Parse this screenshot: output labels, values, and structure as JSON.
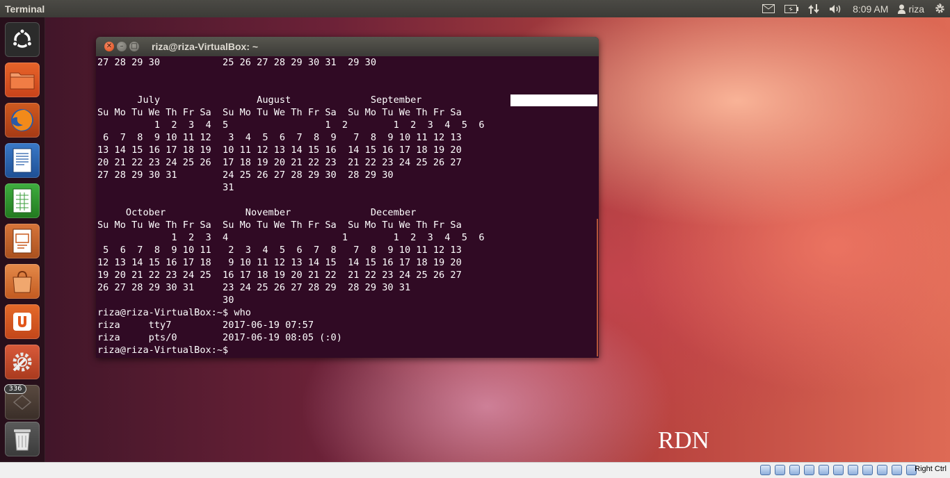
{
  "top_panel": {
    "app_title": "Terminal",
    "clock": "8:09 AM",
    "user": "riza",
    "icons": [
      "mail-icon",
      "battery-icon",
      "network-icon",
      "volume-icon",
      "user-icon",
      "gear-icon"
    ]
  },
  "launcher": {
    "items": [
      "ubuntu-logo",
      "files",
      "firefox",
      "libreoffice-writer",
      "libreoffice-calc",
      "libreoffice-impress",
      "software-center",
      "ubuntu-one",
      "system-settings",
      "workspace-switcher",
      "trash"
    ],
    "badge": "336"
  },
  "window": {
    "title": "riza@riza-VirtualBox: ~",
    "lines": [
      "27 28 29 30           25 26 27 28 29 30 31  29 30",
      "",
      "",
      "       July                 August              September",
      "Su Mo Tu We Th Fr Sa  Su Mo Tu We Th Fr Sa  Su Mo Tu We Th Fr Sa",
      "          1  2  3  4  5                 1  2        1  2  3  4  5  6",
      " 6  7  8  9 10 11 12   3  4  5  6  7  8  9   7  8  9 10 11 12 13",
      "13 14 15 16 17 18 19  10 11 12 13 14 15 16  14 15 16 17 18 19 20",
      "20 21 22 23 24 25 26  17 18 19 20 21 22 23  21 22 23 24 25 26 27",
      "27 28 29 30 31        24 25 26 27 28 29 30  28 29 30",
      "                      31",
      "",
      "     October              November              December",
      "Su Mo Tu We Th Fr Sa  Su Mo Tu We Th Fr Sa  Su Mo Tu We Th Fr Sa",
      "             1  2  3  4                    1        1  2  3  4  5  6",
      " 5  6  7  8  9 10 11   2  3  4  5  6  7  8   7  8  9 10 11 12 13",
      "12 13 14 15 16 17 18   9 10 11 12 13 14 15  14 15 16 17 18 19 20",
      "19 20 21 22 23 24 25  16 17 18 19 20 21 22  21 22 23 24 25 26 27",
      "26 27 28 29 30 31     23 24 25 26 27 28 29  28 29 30 31",
      "                      30",
      "riza@riza-VirtualBox:~$ who",
      "riza     tty7         2017-06-19 07:57",
      "riza     pts/0        2017-06-19 08:05 (:0)",
      "riza@riza-VirtualBox:~$"
    ]
  },
  "statusbar": {
    "host_key": "Right Ctrl"
  },
  "watermark": "RDN"
}
